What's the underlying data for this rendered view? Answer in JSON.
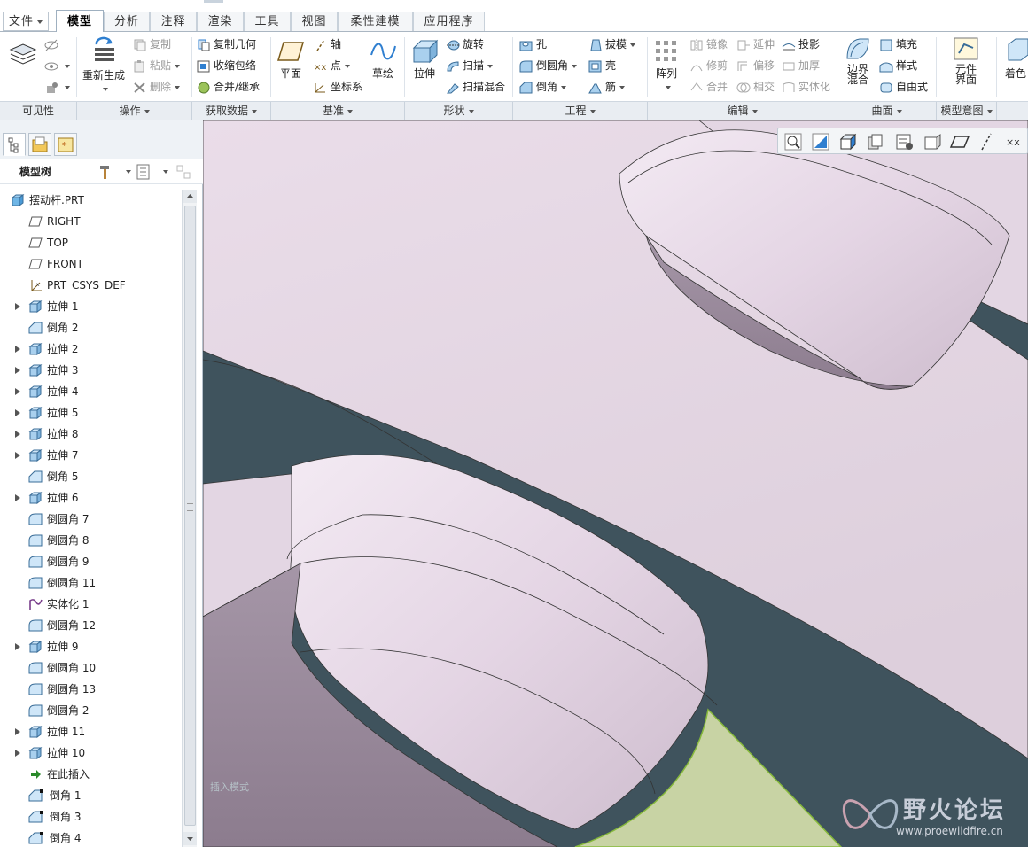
{
  "tabs": [
    {
      "label": "文件"
    },
    {
      "label": "模型"
    },
    {
      "label": "分析"
    },
    {
      "label": "注释"
    },
    {
      "label": "渲染"
    },
    {
      "label": "工具"
    },
    {
      "label": "视图"
    },
    {
      "label": "柔性建模"
    },
    {
      "label": "应用程序"
    }
  ],
  "ribbon": {
    "regenerate": "重新生成",
    "copy": "复制",
    "paste": "粘贴",
    "delete": "删除",
    "copy_geometry": "复制几何",
    "shrinkwrap": "收缩包络",
    "merge_inherit": "合并/继承",
    "plane": "平面",
    "axis": "轴",
    "point": "点",
    "csys": "坐标系",
    "sketch": "草绘",
    "extrude": "拉伸",
    "revolve": "旋转",
    "sweep": "扫描",
    "swept_blend": "扫描混合",
    "hole": "孔",
    "round": "倒圆角",
    "chamfer": "倒角",
    "draft": "拔模",
    "shell": "壳",
    "rib": "筋",
    "pattern": "阵列",
    "mirror": "镜像",
    "trim": "修剪",
    "merge": "合并",
    "extend": "延伸",
    "offset": "偏移",
    "intersect": "相交",
    "project": "投影",
    "thicken": "加厚",
    "solidify": "实体化",
    "boundary_blend": "边界混合",
    "fill": "填充",
    "style": "样式",
    "freestyle": "自由式",
    "component_interface": "元件界面",
    "appearance": "着色"
  },
  "groups": [
    {
      "label": "可见性"
    },
    {
      "label": "操作"
    },
    {
      "label": "获取数据"
    },
    {
      "label": "基准"
    },
    {
      "label": "形状"
    },
    {
      "label": "工程"
    },
    {
      "label": "编辑"
    },
    {
      "label": "曲面"
    },
    {
      "label": "模型意图"
    }
  ],
  "tree": {
    "title": "模型树",
    "items": [
      {
        "label": "摆动杆.PRT"
      },
      {
        "label": "RIGHT"
      },
      {
        "label": "TOP"
      },
      {
        "label": "FRONT"
      },
      {
        "label": "PRT_CSYS_DEF"
      },
      {
        "label": "拉伸 1"
      },
      {
        "label": "倒角 2"
      },
      {
        "label": "拉伸 2"
      },
      {
        "label": "拉伸 3"
      },
      {
        "label": "拉伸 4"
      },
      {
        "label": "拉伸 5"
      },
      {
        "label": "拉伸 8"
      },
      {
        "label": "拉伸 7"
      },
      {
        "label": "倒角 5"
      },
      {
        "label": "拉伸 6"
      },
      {
        "label": "倒圆角 7"
      },
      {
        "label": "倒圆角 8"
      },
      {
        "label": "倒圆角 9"
      },
      {
        "label": "倒圆角 11"
      },
      {
        "label": "实体化 1"
      },
      {
        "label": "倒圆角 12"
      },
      {
        "label": "拉伸 9"
      },
      {
        "label": "倒圆角 10"
      },
      {
        "label": "倒圆角 13"
      },
      {
        "label": "倒圆角 2"
      },
      {
        "label": "拉伸 11"
      },
      {
        "label": "拉伸 10"
      },
      {
        "label": "在此插入"
      },
      {
        "label": "倒角 1"
      },
      {
        "label": "倒角 3"
      },
      {
        "label": "倒角 4"
      }
    ]
  },
  "viewport": {
    "insert_mode": "插入模式",
    "watermark_title": "野火论坛",
    "watermark_url": "www.proewildfire.cn"
  },
  "colors": {
    "accent_blue": "#2f7fd0",
    "model_pink": "#e6d8e6",
    "model_shadow": "#9a8a9c",
    "bg_dark": "#3f535d",
    "highlight_green": "#c8d3a4"
  }
}
